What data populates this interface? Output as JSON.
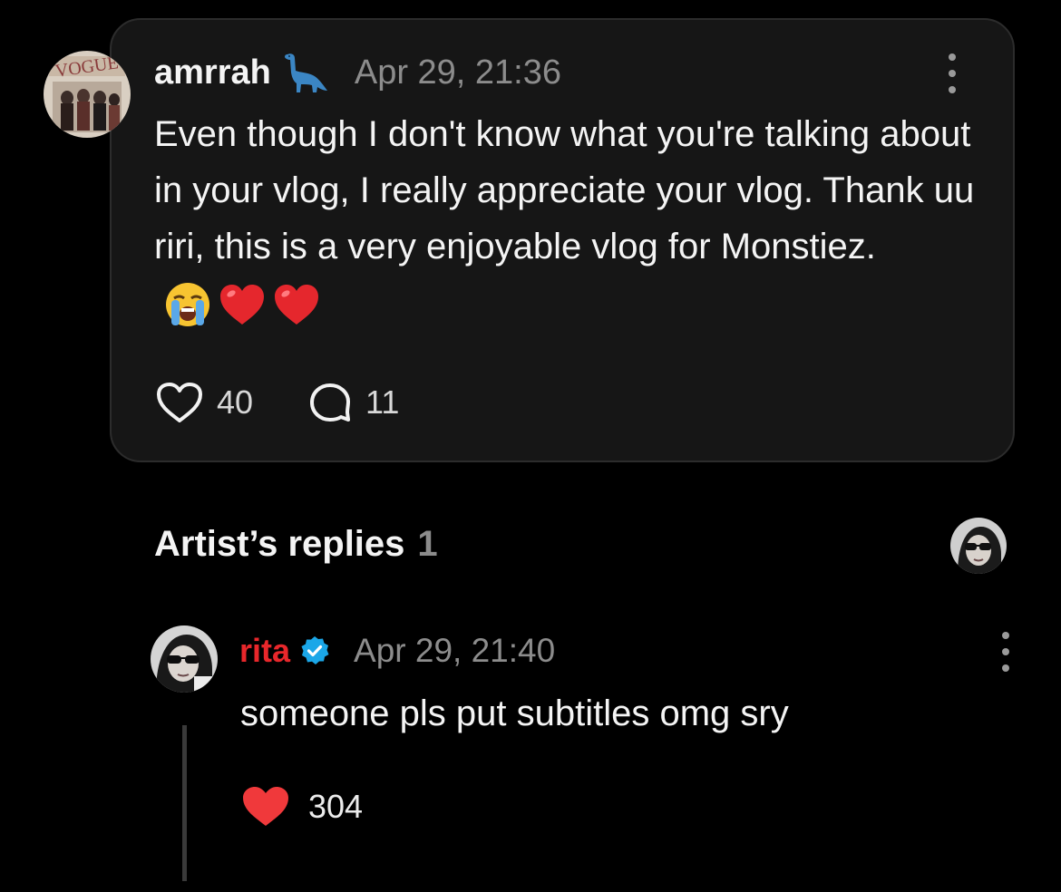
{
  "comment": {
    "author": "amrrah",
    "author_badge_icon": "dinosaur-icon",
    "timestamp": "Apr 29, 21:36",
    "text": "Even though I don't know what you're talking about in your vlog, I really appreciate your vlog. Thank uu riri, this is a very enjoyable vlog for Monstiez.",
    "emojis": [
      "loudly-crying-face-icon",
      "red-heart-icon",
      "red-heart-icon"
    ],
    "likes": "40",
    "replies": "11"
  },
  "artist_replies": {
    "title": "Artist’s replies",
    "count": "1"
  },
  "reply": {
    "author": "rita",
    "verified": true,
    "timestamp": "Apr 29, 21:40",
    "text": "someone pls put subtitles omg sry",
    "likes": "304",
    "liked": true
  },
  "colors": {
    "background": "#000000",
    "card": "#161616",
    "artist_name": "#e8272b",
    "verified": "#1ba7e8",
    "liked_heart": "#f0393b",
    "muted_text": "#8c8c8c"
  }
}
